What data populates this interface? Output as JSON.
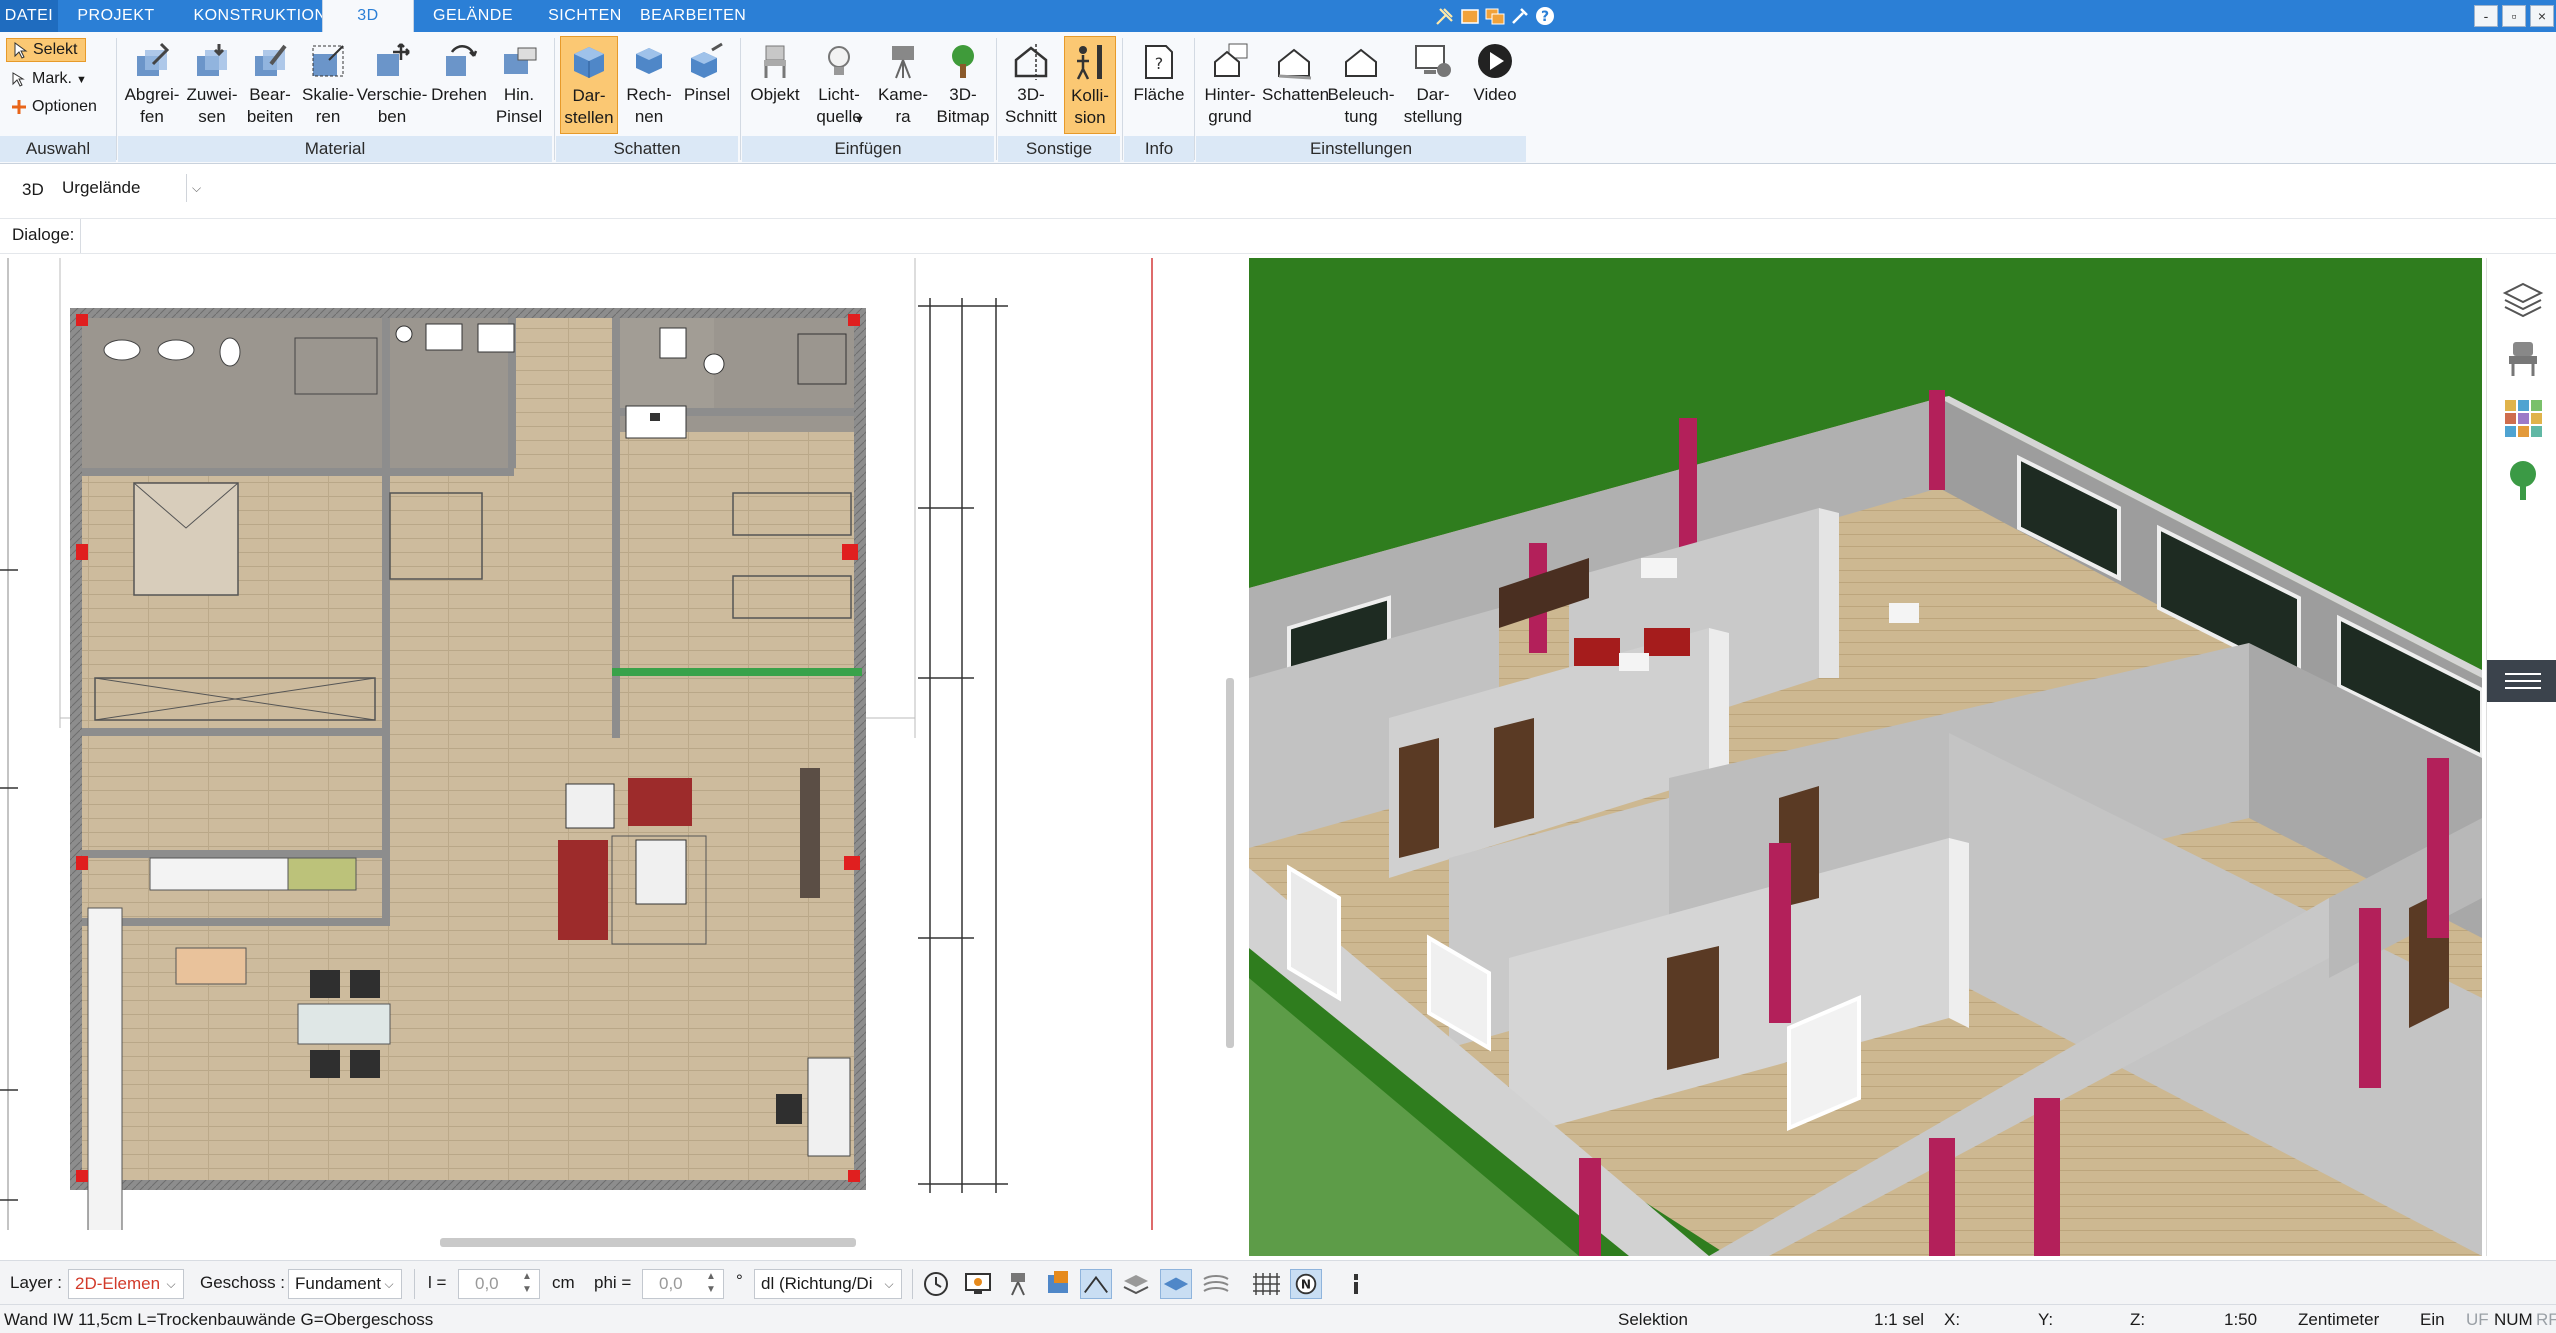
{
  "tabs": [
    "DATEI",
    "PROJEKT",
    "KONSTRUKTION",
    "3D",
    "GELÄNDE",
    "SICHTEN",
    "BEARBEITEN"
  ],
  "window_controls": {
    "minimize": "-",
    "restore": "▫",
    "close": "×"
  },
  "ribbon": {
    "auswahl": {
      "select": "Selekt",
      "mark": "Mark.",
      "options": "Optionen"
    },
    "buttons": {
      "abgreifen": "Abgrei-\nfen",
      "zuweisen": "Zuwei-\nsen",
      "bearbeiten": "Bear-\nbeiten",
      "skalieren": "Skalie-\nren",
      "verschieben": "Verschie-\nben",
      "drehen": "Drehen",
      "hinpinsel": "Hin.\nPinsel",
      "darstellen": "Dar-\nstellen",
      "rechnen": "Rech-\nnen",
      "pinsel": "Pinsel",
      "objekt": "Objekt",
      "lichtquelle": "Licht-\nquelle",
      "kamera": "Kame-\nra",
      "bitmap3d": "3D-\nBitmap",
      "schnitt3d": "3D-\nSchnitt",
      "kollision": "Kolli-\nsion",
      "flaeche": "Fläche",
      "hintergrund": "Hinter-\ngrund",
      "schatten": "Schatten",
      "beleuchtung": "Beleuch-\ntung",
      "darstellung": "Dar-\nstellung",
      "video": "Video"
    },
    "groups": {
      "auswahl": "Auswahl",
      "material": "Material",
      "schatten": "Schatten",
      "einfuegen": "Einfügen",
      "sonstige": "Sonstige",
      "info": "Info",
      "einstellungen": "Einstellungen"
    }
  },
  "mode_row": {
    "label": "3D",
    "terrain": "Urgelände"
  },
  "dialogs_label": "Dialoge:",
  "statusbar": {
    "layer_label": "Layer :",
    "layer_value": "2D-Elemen",
    "storey_label": "Geschoss :",
    "storey_value": "Fundament",
    "l_label": "l =",
    "l_value": "0,0",
    "l_unit": "cm",
    "phi_label": "phi =",
    "phi_value": "0,0",
    "phi_unit": "°",
    "direction_value": "dl (Richtung/Di"
  },
  "infobar": {
    "element": "Wand IW 11,5cm L=Trockenbauwände G=Obergeschoss",
    "mode": "Selektion",
    "selection": "1:1 sel",
    "x": "X:",
    "y": "Y:",
    "z": "Z:",
    "scale": "1:50",
    "unit": "Zentimeter",
    "ein": "Ein",
    "uf": "UF",
    "num": "NUM",
    "rf": "RF"
  },
  "colors": {
    "tab_bar": "#2b7fd6",
    "active_button": "#fbc873",
    "group_label_bg": "#dbe8f6",
    "grass": "#2f7d1e",
    "floor": "#c9b79a",
    "wall": "#b8b8b8",
    "accent_pillar": "#b3205a"
  }
}
